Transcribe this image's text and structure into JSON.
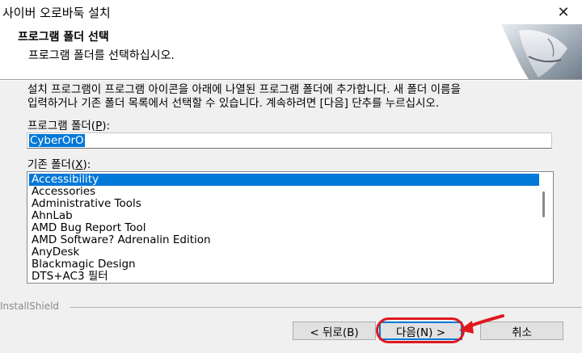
{
  "window": {
    "title": "사이버 오로바둑 설치"
  },
  "header": {
    "title": "프로그램 폴더 선택",
    "subtitle": "프로그램 폴더를 선택하십시오."
  },
  "description": {
    "line1": "설치 프로그램이 프로그램 아이콘을 아래에 나열된 프로그램 폴더에 추가합니다. 새 폴더 이름을",
    "line2": "입력하거나 기존 폴더 목록에서 선택할 수 있습니다. 계속하려면 [다음] 단추를 누르십시오."
  },
  "program_folder": {
    "label_pre": "프로그램 폴더(",
    "label_key": "P",
    "label_post": "):",
    "value": "CyberOrO"
  },
  "existing_folders": {
    "label_pre": "기존 폴더(",
    "label_key": "X",
    "label_post": "):",
    "items": [
      "Accessibility",
      "Accessories",
      "Administrative Tools",
      "AhnLab",
      "AMD Bug Report Tool",
      "AMD Software? Adrenalin Edition",
      "AnyDesk",
      "Blackmagic Design",
      "DTS+AC3 필터"
    ],
    "selected_index": 0
  },
  "footer": {
    "brand": "InstallShield"
  },
  "buttons": {
    "back": "< 뒤로(B)",
    "next": "다음(N) >",
    "cancel": "취소"
  },
  "colors": {
    "selection": "#0078d7",
    "annotation": "#e0181e"
  }
}
